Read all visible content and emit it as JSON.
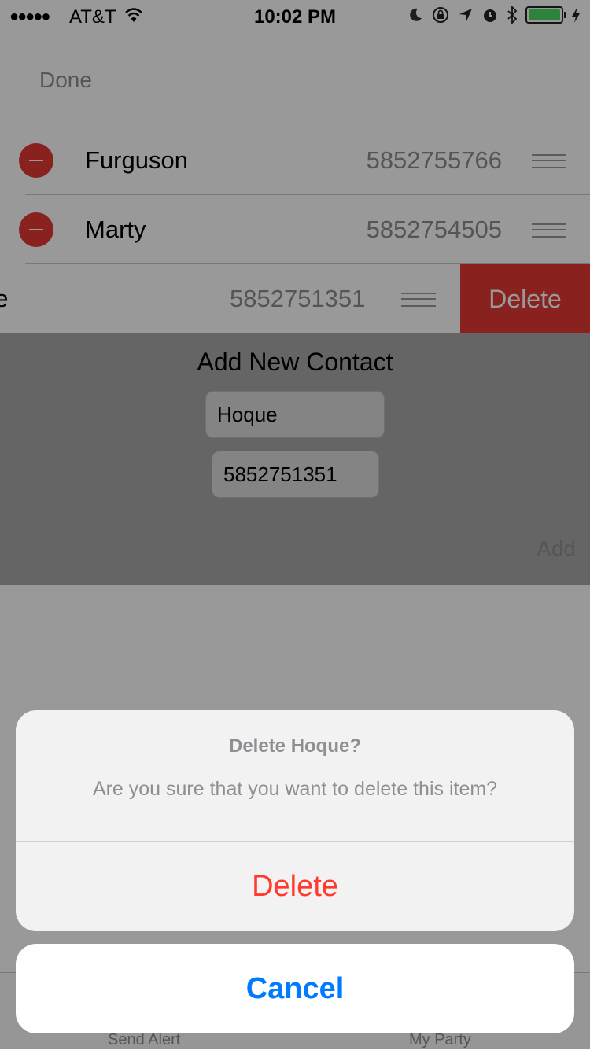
{
  "status": {
    "carrier": "AT&T",
    "time": "10:02 PM",
    "signal": "●●●●●"
  },
  "nav": {
    "done_label": "Done"
  },
  "contacts": [
    {
      "name": "Furguson",
      "phone": "5852755766"
    },
    {
      "name": "Marty",
      "phone": "5852754505"
    }
  ],
  "swiped_contact": {
    "name_visible": "ue",
    "phone": "5852751351",
    "delete_label": "Delete"
  },
  "add_form": {
    "title": "Add New Contact",
    "name_value": "Hoque",
    "phone_value": "5852751351",
    "add_label": "Add"
  },
  "tabbar": {
    "tabs": [
      {
        "label": "Send Alert"
      },
      {
        "label": "My Party"
      }
    ]
  },
  "action_sheet": {
    "title": "Delete Hoque?",
    "message": "Are you sure that you want to delete this item?",
    "delete_label": "Delete",
    "cancel_label": "Cancel"
  },
  "colors": {
    "destructive": "#ff3b30",
    "accent": "#007aff",
    "delete_row": "#e53935",
    "battery": "#4cd964"
  }
}
